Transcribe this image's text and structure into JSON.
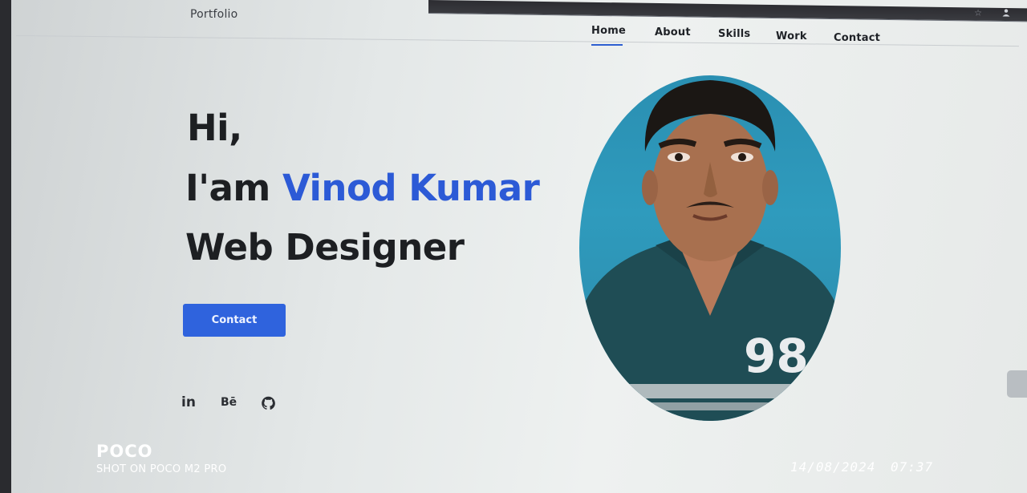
{
  "header": {
    "logo": "Portfolio",
    "nav": [
      {
        "label": "Home",
        "active": true
      },
      {
        "label": "About"
      },
      {
        "label": "Skills"
      },
      {
        "label": "Work"
      },
      {
        "label": "Contact"
      }
    ]
  },
  "hero": {
    "greeting": "Hi,",
    "intro": "I'am ",
    "name": "Vinod Kumar",
    "role": "Web Designer",
    "contact_button": "Contact"
  },
  "social": [
    {
      "label": "in",
      "icon": "linkedin-icon"
    },
    {
      "label": "Bē",
      "icon": "behance-icon"
    },
    {
      "label": "",
      "icon": "github-icon"
    }
  ],
  "photo": {
    "shirt_number": "98"
  },
  "watermark": {
    "brand": "POCO",
    "subtitle": "SHOT ON POCO M2 PRO",
    "date": "14/08/2024",
    "time": "07:37"
  },
  "colors": {
    "accent": "#2f63dd",
    "name_text": "#2c5ad6",
    "heading_text": "#1d1f22"
  }
}
